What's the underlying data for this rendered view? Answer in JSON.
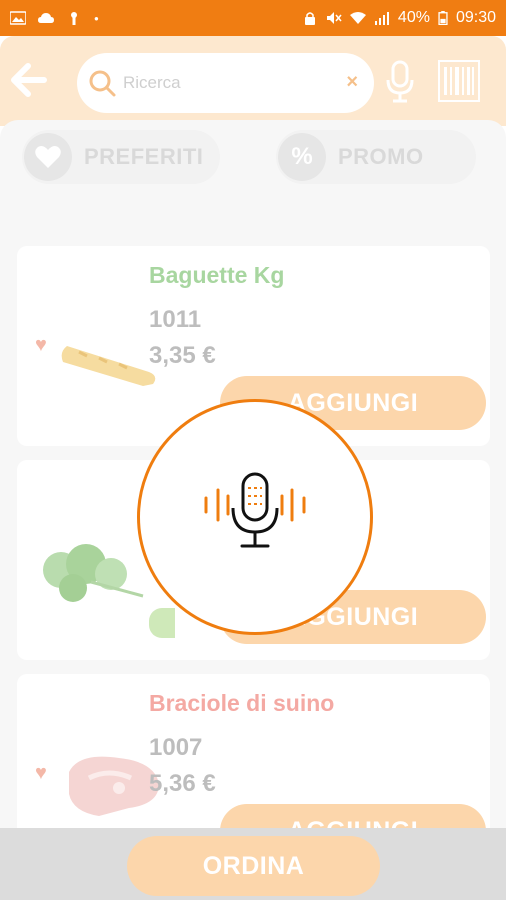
{
  "status_bar": {
    "battery": "40%",
    "time": "09:30"
  },
  "header": {
    "search_placeholder": "Ricerca",
    "clear_symbol": "×"
  },
  "filters": [
    {
      "label": "PREFERITI",
      "icon": "heart-icon"
    },
    {
      "label": "PROMO",
      "icon": "percent-icon",
      "symbol": "%"
    }
  ],
  "products": [
    {
      "name": "Baguette Kg",
      "code": "1011",
      "price": "3,35 €",
      "add_label": "AGGIUNGI",
      "name_color": "#a8d6a0"
    },
    {
      "name": "",
      "code": "",
      "price": "",
      "add_label": "AGGIUNGI",
      "name_color": "#c0b8f0"
    },
    {
      "name": "Braciole di suino",
      "code": "1007",
      "price": "5,36 €",
      "add_label": "AGGIUNGI",
      "name_color": "#f4a9a3"
    }
  ],
  "footer": {
    "order_label": "ORDINA"
  },
  "colors": {
    "accent": "#ef7d0f",
    "accent_light": "#fcd6ab"
  }
}
